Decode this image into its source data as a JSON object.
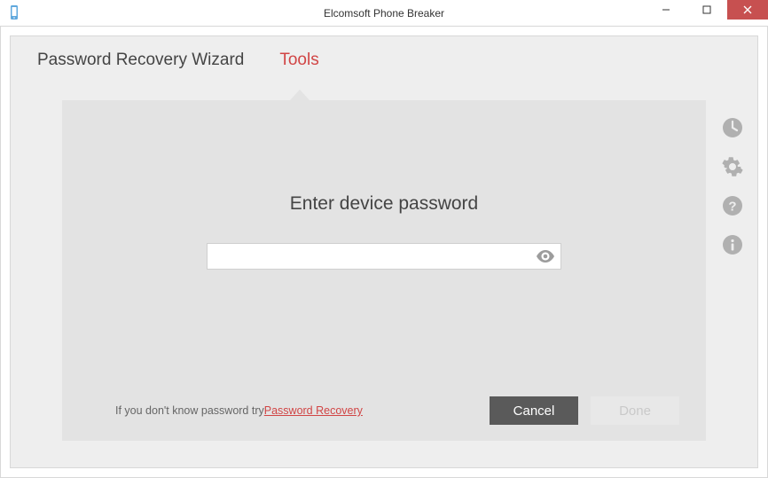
{
  "window": {
    "title": "Elcomsoft Phone Breaker"
  },
  "tabs": {
    "recovery": "Password Recovery Wizard",
    "tools": "Tools"
  },
  "content": {
    "prompt": "Enter device password",
    "password_value": "",
    "password_placeholder": ""
  },
  "hint": {
    "prefix": "If you don't know password try",
    "link": "Password Recovery"
  },
  "buttons": {
    "cancel": "Cancel",
    "done": "Done"
  }
}
